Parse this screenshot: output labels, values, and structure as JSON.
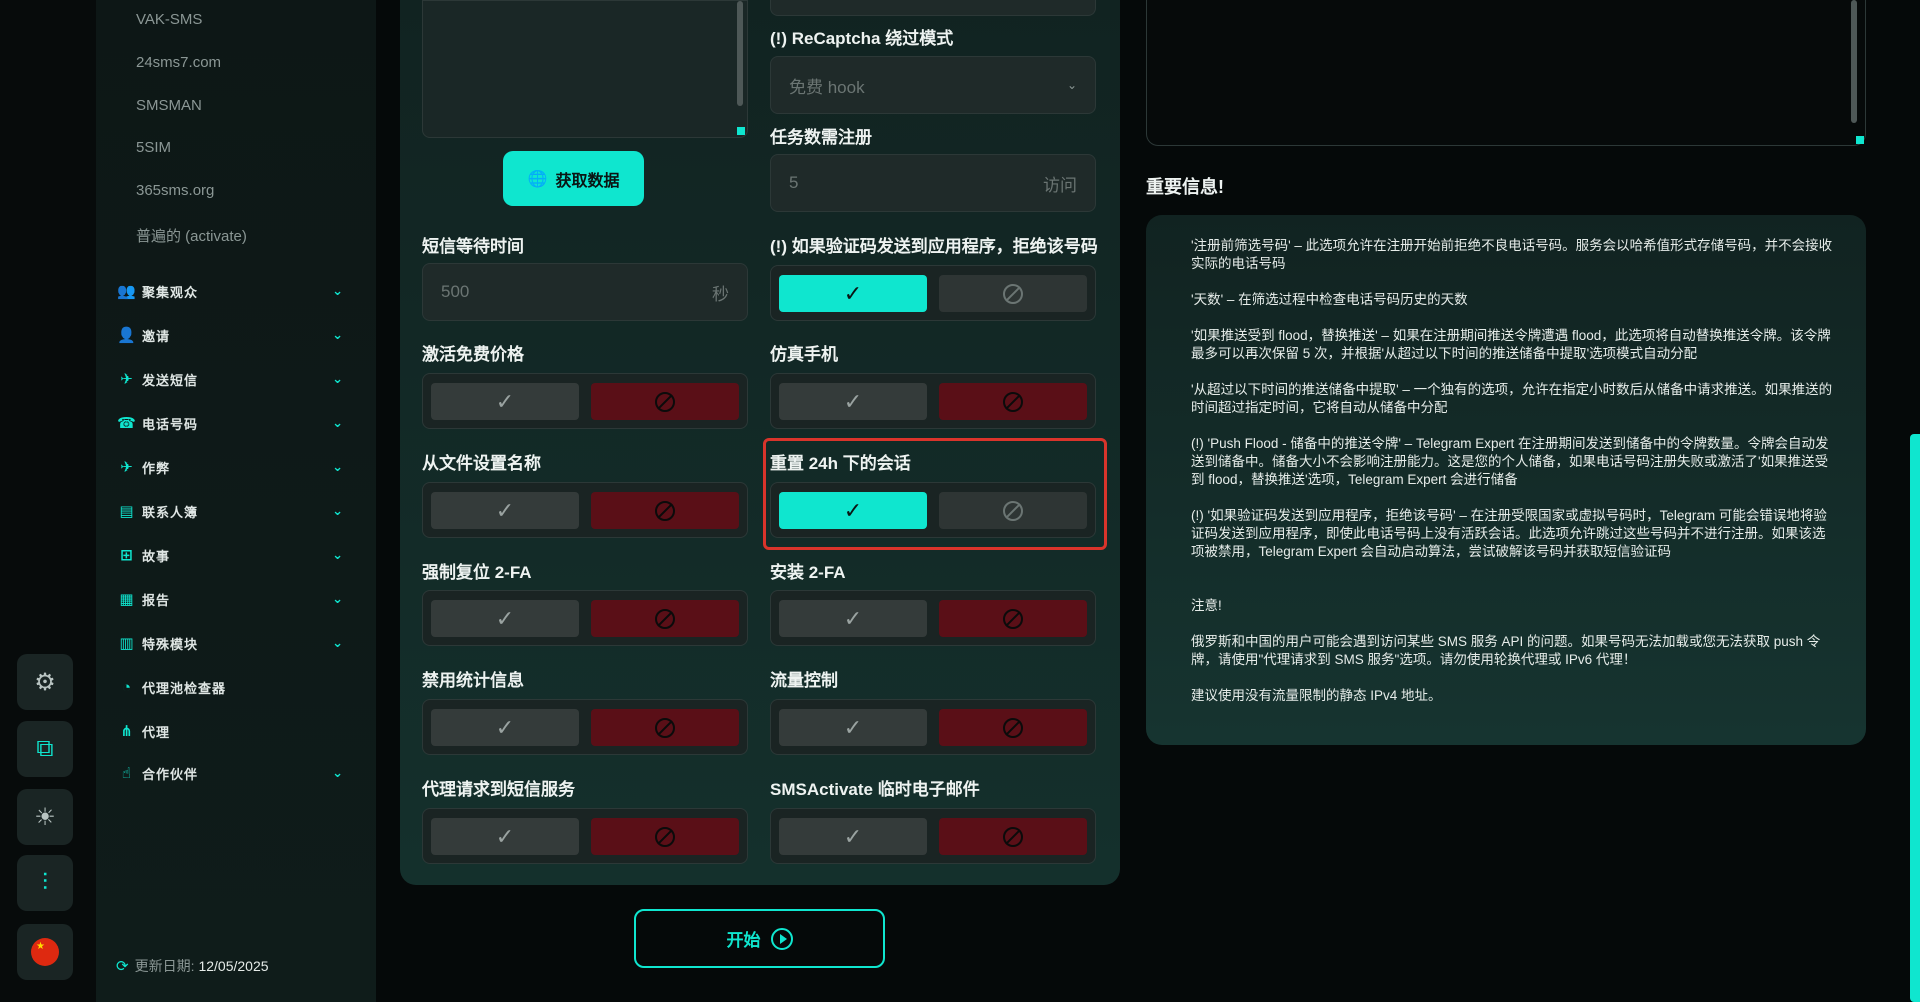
{
  "sidebar": {
    "sms_services": [
      "VAK-SMS",
      "24sms7.com",
      "SMSMAN",
      "5SIM",
      "365sms.org",
      "普遍的 (activate)"
    ],
    "nav": [
      {
        "label": "聚集观众",
        "icon": "👥"
      },
      {
        "label": "邀请",
        "icon": "👤"
      },
      {
        "label": "发送短信",
        "icon": "✈"
      },
      {
        "label": "电话号码",
        "icon": "☎"
      },
      {
        "label": "作弊",
        "icon": "✈"
      },
      {
        "label": "联系人簿",
        "icon": "▤"
      },
      {
        "label": "故事",
        "icon": "⊞"
      },
      {
        "label": "报告",
        "icon": "▦"
      },
      {
        "label": "特殊模块",
        "icon": "▥"
      },
      {
        "label": "代理池检查器",
        "icon": "◔"
      },
      {
        "label": "代理",
        "icon": "⋔"
      },
      {
        "label": "合作伙伴",
        "icon": "☝"
      }
    ],
    "update_label": "更新日期:",
    "update_date": "12/05/2025"
  },
  "main": {
    "fetch_button": "获取数据",
    "sms_wait_label": "短信等待时间",
    "sms_wait_value": "500",
    "sms_wait_unit": "秒",
    "recaptcha_label": "(!) ReCaptcha 绕过模式",
    "recaptcha_value": "免费 hook",
    "tasks_label": "任务数需注册",
    "tasks_value": "5",
    "tasks_unit": "访问",
    "toggles": {
      "reject_code_app": {
        "label": "(!) 如果验证码发送到应用程序，拒绝该号码",
        "value": true
      },
      "activation_free_price": {
        "label": "激活免费价格",
        "value": false
      },
      "emulate_phone": {
        "label": "仿真手机",
        "value": false
      },
      "name_from_file": {
        "label": "从文件设置名称",
        "value": false
      },
      "reset_sessions_24h": {
        "label": "重置 24h 下的会话",
        "value": true
      },
      "force_reset_2fa": {
        "label": "强制复位 2-FA",
        "value": false
      },
      "install_2fa": {
        "label": "安装 2-FA",
        "value": false
      },
      "disable_stats": {
        "label": "禁用统计信息",
        "value": false
      },
      "traffic_control": {
        "label": "流量控制",
        "value": false
      },
      "proxy_sms_requests": {
        "label": "代理请求到短信服务",
        "value": false
      },
      "smsactivate_temp_mail": {
        "label": "SMSActivate 临时电子邮件",
        "value": false
      }
    },
    "start_button": "开始"
  },
  "info": {
    "title": "重要信息!",
    "paragraphs": [
      "'注册前筛选号码' – 此选项允许在注册开始前拒绝不良电话号码。服务会以哈希值形式存储号码，并不会接收实际的电话号码",
      "'天数' – 在筛选过程中检查电话号码历史的天数",
      "'如果推送受到 flood，替换推送' – 如果在注册期间推送令牌遭遇 flood，此选项将自动替换推送令牌。该令牌最多可以再次保留 5 次，并根据'从超过以下时间的推送储备中提取'选项模式自动分配",
      "'从超过以下时间的推送储备中提取' – 一个独有的选项，允许在指定小时数后从储备中请求推送。如果推送的时间超过指定时间，它将自动从储备中分配",
      "(!) 'Push Flood - 储备中的推送令牌' – Telegram Expert 在注册期间发送到储备中的令牌数量。令牌会自动发送到储备中。储备大小不会影响注册能力。这是您的个人储备，如果电话号码注册失败或激活了'如果推送受到 flood，替换推送'选项，Telegram Expert 会进行储备",
      "(!) '如果验证码发送到应用程序，拒绝该号码' – 在注册受限国家或虚拟号码时，Telegram 可能会错误地将验证码发送到应用程序，即使此电话号码上没有活跃会话。此选项允许跳过这些号码并不进行注册。如果该选项被禁用，Telegram Expert 会自动启动算法，尝试破解该号码并获取短信验证码",
      "注意!",
      "俄罗斯和中国的用户可能会遇到访问某些 SMS 服务 API 的问题。如果号码无法加载或您无法获取 push 令牌，请使用\"代理请求到 SMS 服务\"选项。请勿使用轮换代理或 IPv6 代理！",
      "建议使用没有流量限制的静态 IPv4 地址。"
    ]
  },
  "rail": [
    "gear-icon",
    "external-link-icon",
    "sun-icon",
    "sliders-icon",
    "flag-cn-icon"
  ],
  "colors": {
    "accent": "#0fe6cf",
    "danger": "#5a0f17",
    "highlight": "#d9342b"
  }
}
